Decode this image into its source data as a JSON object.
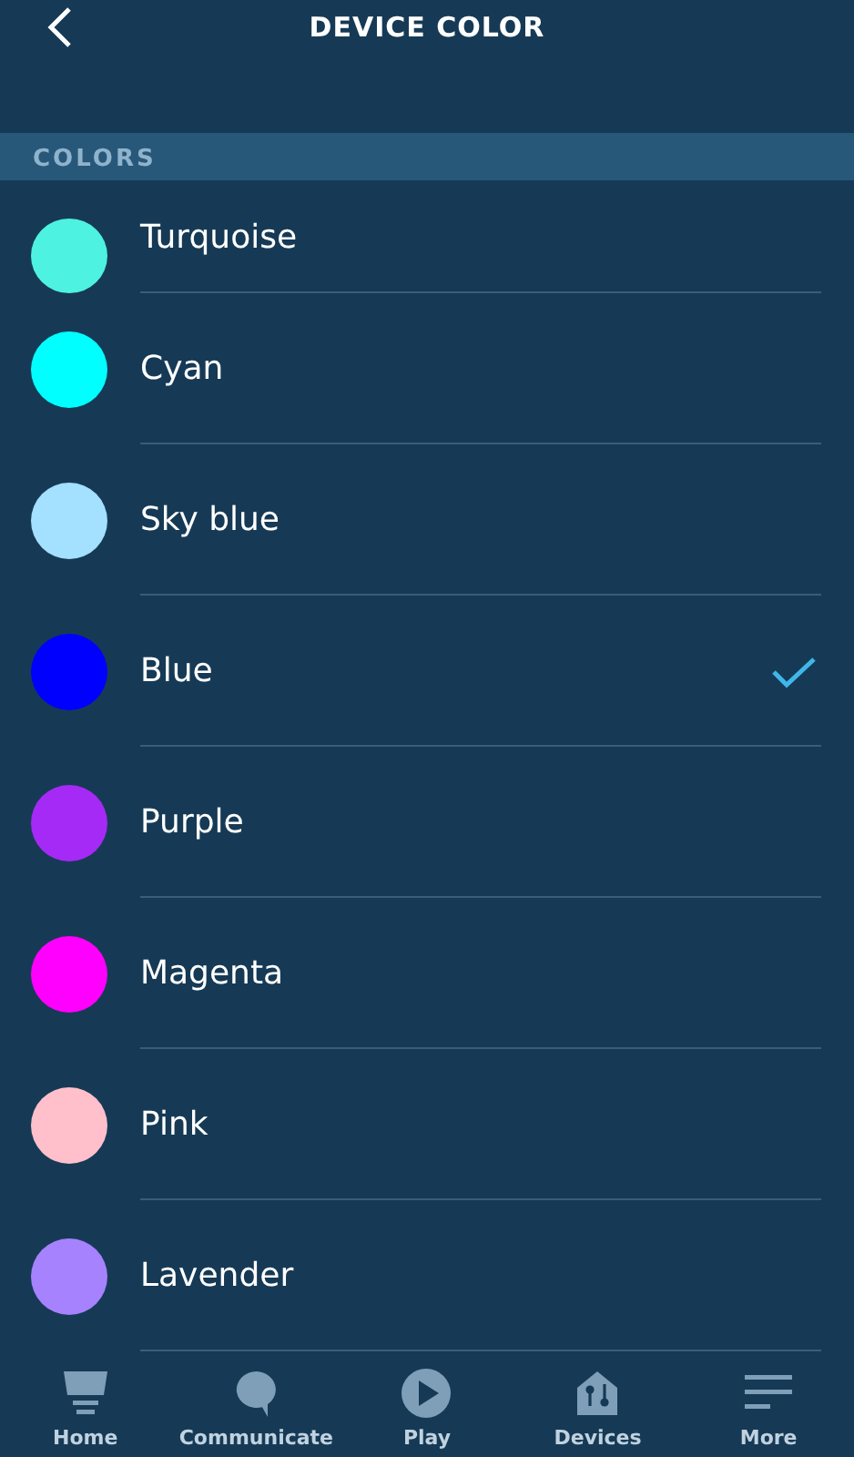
{
  "header": {
    "title": "DEVICE COLOR"
  },
  "section": {
    "label": "COLORS"
  },
  "colors": [
    {
      "name": "Turquoise",
      "color": "#4ef2e0",
      "selected": false
    },
    {
      "name": "Cyan",
      "color": "#00ffff",
      "selected": false
    },
    {
      "name": "Sky blue",
      "color": "#a4e0ff",
      "selected": false
    },
    {
      "name": "Blue",
      "color": "#0000ff",
      "selected": true
    },
    {
      "name": "Purple",
      "color": "#a52af5",
      "selected": false
    },
    {
      "name": "Magenta",
      "color": "#ff00ff",
      "selected": false
    },
    {
      "name": "Pink",
      "color": "#ffc0cb",
      "selected": false
    },
    {
      "name": "Lavender",
      "color": "#a682ff",
      "selected": false
    }
  ],
  "nav": [
    {
      "label": "Home",
      "kind": "home"
    },
    {
      "label": "Communicate",
      "kind": "communicate"
    },
    {
      "label": "Play",
      "kind": "play"
    },
    {
      "label": "Devices",
      "kind": "devices"
    },
    {
      "label": "More",
      "kind": "more"
    }
  ]
}
